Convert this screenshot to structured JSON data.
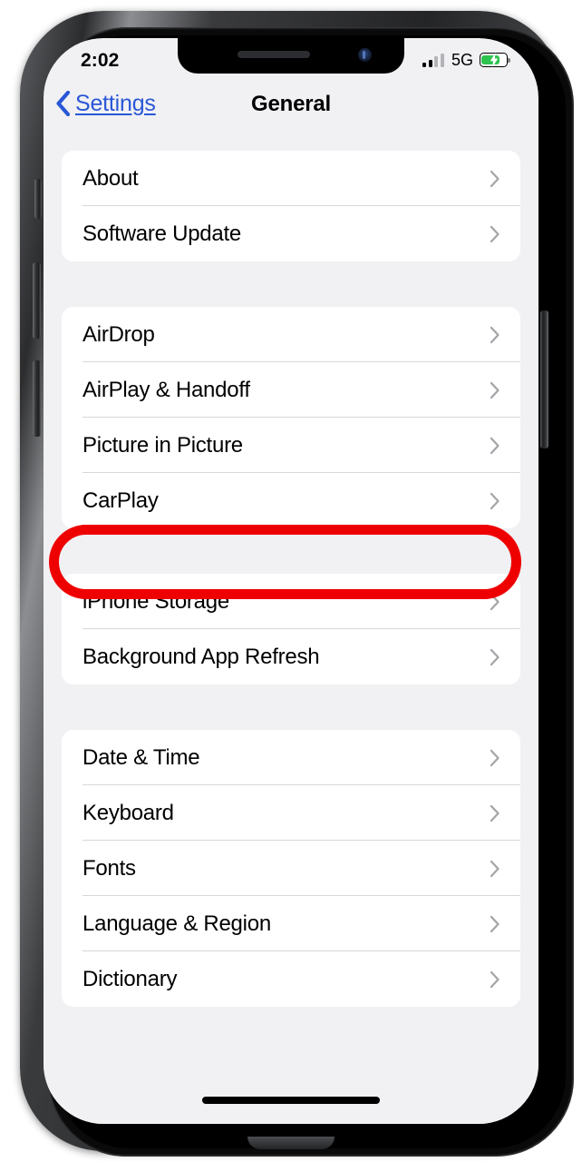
{
  "device": {
    "name": "iphone-frame",
    "home_indicator": "home-indicator"
  },
  "status_bar": {
    "time": "2:02",
    "network_type": "5G",
    "signal_bars_total": 4,
    "signal_bars_filled": 2,
    "battery_percent": 75,
    "battery_charging": true,
    "battery_color": "#2ec24e",
    "icons": {
      "signal": "cellular-signal-icon",
      "battery": "battery-charging-icon"
    }
  },
  "nav_bar": {
    "back_label": "Settings",
    "back_icon": "chevron-left-icon",
    "title": "General",
    "back_link_color": "#2a57d6"
  },
  "annotation": {
    "shape": "oval",
    "color": "#ef0000",
    "target_row": "CarPlay"
  },
  "list": {
    "chevron_icon": "chevron-right-icon",
    "groups": [
      {
        "id": "group-system",
        "rows": [
          {
            "label": "About"
          },
          {
            "label": "Software Update"
          }
        ]
      },
      {
        "id": "group-connectivity",
        "rows": [
          {
            "label": "AirDrop"
          },
          {
            "label": "AirPlay & Handoff"
          },
          {
            "label": "Picture in Picture"
          },
          {
            "label": "CarPlay"
          }
        ]
      },
      {
        "id": "group-storage",
        "rows": [
          {
            "label": "iPhone Storage"
          },
          {
            "label": "Background App Refresh"
          }
        ]
      },
      {
        "id": "group-localization",
        "rows": [
          {
            "label": "Date & Time"
          },
          {
            "label": "Keyboard"
          },
          {
            "label": "Fonts"
          },
          {
            "label": "Language & Region"
          },
          {
            "label": "Dictionary"
          }
        ]
      }
    ]
  }
}
